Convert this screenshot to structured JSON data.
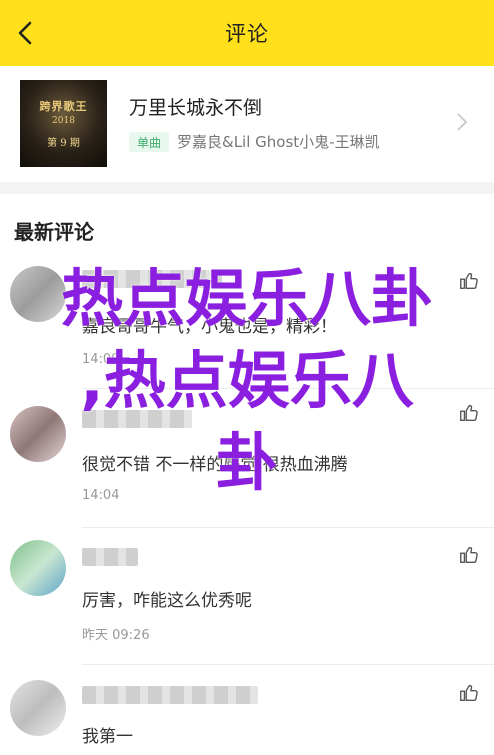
{
  "header": {
    "title": "评论"
  },
  "song": {
    "title": "万里长城永不倒",
    "tag": "单曲",
    "artist": "罗嘉良&Lil Ghost小鬼-王琳凯",
    "cover": {
      "line1": "跨界歌王",
      "line2": "2018",
      "line3": "第 9 期"
    }
  },
  "section": {
    "title": "最新评论"
  },
  "comments": [
    {
      "text": "嘉良哥哥牛气，小鬼也是，精彩！",
      "time": "14:09"
    },
    {
      "text": "很觉不错 不一样的感觉 很热血沸腾",
      "time": "14:04"
    },
    {
      "text": "厉害，咋能这么优秀呢",
      "time": "昨天 09:26"
    },
    {
      "text": "我第一",
      "time": ""
    }
  ],
  "overlay": {
    "line1": "热点娱乐八卦",
    "line2": ",热点娱乐八",
    "line3": "卦"
  },
  "colors": {
    "header_bg": "#ffe01a",
    "overlay_text": "#8a1fe0",
    "tag_green": "#3fae6b"
  }
}
